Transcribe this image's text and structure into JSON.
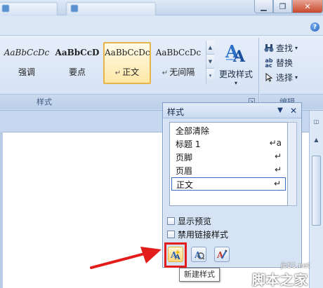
{
  "ribbon": {
    "styles_gallery": [
      {
        "sample": "AaBbCcDc",
        "name": "强调"
      },
      {
        "sample": "AaBbCcD",
        "name": "要点"
      },
      {
        "sample": "AaBbCcDc",
        "name": "正文",
        "selected": true
      },
      {
        "sample": "AaBbCcDc",
        "name": "无间隔"
      }
    ],
    "change_styles_label": "更改样式",
    "styles_group_label": "样式",
    "editing": {
      "find_label": "查找",
      "replace_label": "替换",
      "select_label": "选择",
      "group_label": "编辑"
    }
  },
  "styles_pane": {
    "title": "样式",
    "items": [
      {
        "label": "全部清除",
        "mark": ""
      },
      {
        "label": "标题 1",
        "mark": "↵a"
      },
      {
        "label": "页脚",
        "mark": "↵"
      },
      {
        "label": "页眉",
        "mark": "↵"
      },
      {
        "label": "正文",
        "mark": "↵",
        "selected": true
      }
    ],
    "show_preview_label": "显示预览",
    "disable_linked_label": "禁用链接样式",
    "tooltip": "新建样式",
    "show_preview_checked": false,
    "disable_linked_checked": false
  },
  "colors": {
    "highlight": "#e31c1c",
    "selected_style_border": "#e7b449"
  },
  "watermark": {
    "url": "jb51.net",
    "name": "脚本之家"
  }
}
